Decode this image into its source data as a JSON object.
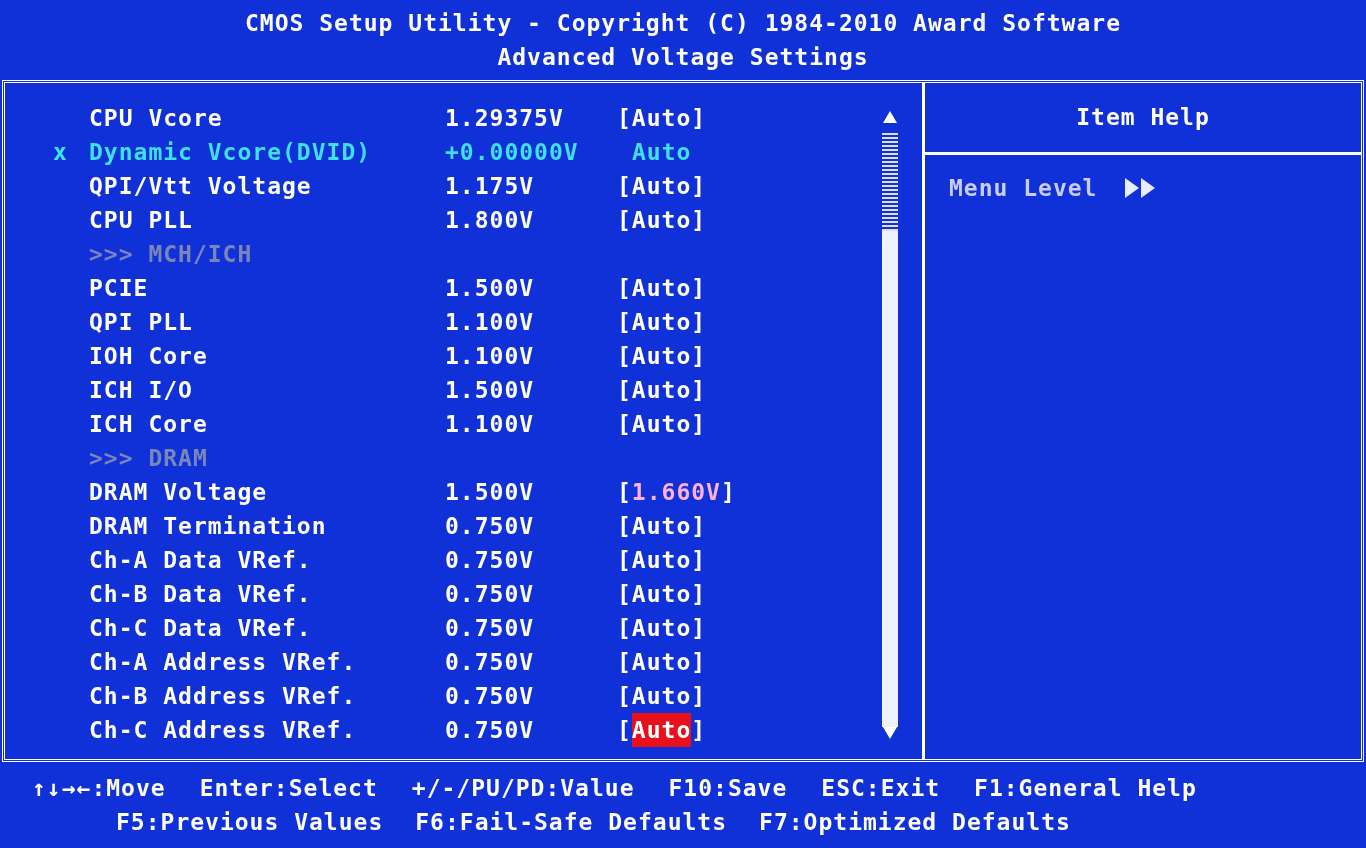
{
  "title": "CMOS Setup Utility - Copyright (C) 1984-2010 Award Software",
  "subtitle": "Advanced Voltage Settings",
  "rows": [
    {
      "kind": "item",
      "label": "CPU Vcore",
      "voltage": "1.29375V",
      "open": "[",
      "setting": "Auto",
      "close": "]",
      "disabled": false,
      "modified": false,
      "selected": false
    },
    {
      "kind": "item",
      "marker": "x",
      "label": "Dynamic Vcore(DVID)",
      "voltage": "+0.00000V",
      "setting": "Auto",
      "disabled": true,
      "modified": false,
      "selected": false
    },
    {
      "kind": "item",
      "label": "QPI/Vtt Voltage",
      "voltage": "1.175V",
      "open": "[",
      "setting": "Auto",
      "close": "]",
      "disabled": false,
      "modified": false,
      "selected": false
    },
    {
      "kind": "item",
      "label": "CPU PLL",
      "voltage": "1.800V",
      "open": "[",
      "setting": "Auto",
      "close": "]",
      "disabled": false,
      "modified": false,
      "selected": false
    },
    {
      "kind": "header",
      "label": ">>> MCH/ICH"
    },
    {
      "kind": "item",
      "label": "PCIE",
      "voltage": "1.500V",
      "open": "[",
      "setting": "Auto",
      "close": "]",
      "disabled": false,
      "modified": false,
      "selected": false
    },
    {
      "kind": "item",
      "label": "QPI PLL",
      "voltage": "1.100V",
      "open": "[",
      "setting": "Auto",
      "close": "]",
      "disabled": false,
      "modified": false,
      "selected": false
    },
    {
      "kind": "item",
      "label": "IOH Core",
      "voltage": "1.100V",
      "open": "[",
      "setting": "Auto",
      "close": "]",
      "disabled": false,
      "modified": false,
      "selected": false
    },
    {
      "kind": "item",
      "label": "ICH I/O",
      "voltage": "1.500V",
      "open": "[",
      "setting": "Auto",
      "close": "]",
      "disabled": false,
      "modified": false,
      "selected": false
    },
    {
      "kind": "item",
      "label": "ICH Core",
      "voltage": "1.100V",
      "open": "[",
      "setting": "Auto",
      "close": "]",
      "disabled": false,
      "modified": false,
      "selected": false
    },
    {
      "kind": "header",
      "label": ">>> DRAM"
    },
    {
      "kind": "item",
      "label": "DRAM Voltage",
      "voltage": "1.500V",
      "open": "[",
      "setting": "1.660V",
      "close": "]",
      "disabled": false,
      "modified": true,
      "selected": false
    },
    {
      "kind": "item",
      "label": "DRAM Termination",
      "voltage": "0.750V",
      "open": "[",
      "setting": "Auto",
      "close": "]",
      "disabled": false,
      "modified": false,
      "selected": false
    },
    {
      "kind": "item",
      "label": "Ch-A Data VRef.",
      "voltage": "0.750V",
      "open": "[",
      "setting": "Auto",
      "close": "]",
      "disabled": false,
      "modified": false,
      "selected": false
    },
    {
      "kind": "item",
      "label": "Ch-B Data VRef.",
      "voltage": "0.750V",
      "open": "[",
      "setting": "Auto",
      "close": "]",
      "disabled": false,
      "modified": false,
      "selected": false
    },
    {
      "kind": "item",
      "label": "Ch-C Data VRef.",
      "voltage": "0.750V",
      "open": "[",
      "setting": "Auto",
      "close": "]",
      "disabled": false,
      "modified": false,
      "selected": false
    },
    {
      "kind": "item",
      "label": "Ch-A Address VRef.",
      "voltage": "0.750V",
      "open": "[",
      "setting": "Auto",
      "close": "]",
      "disabled": false,
      "modified": false,
      "selected": false
    },
    {
      "kind": "item",
      "label": "Ch-B Address VRef.",
      "voltage": "0.750V",
      "open": "[",
      "setting": "Auto",
      "close": "]",
      "disabled": false,
      "modified": false,
      "selected": false
    },
    {
      "kind": "item",
      "label": "Ch-C Address VRef.",
      "voltage": "0.750V",
      "open": "[",
      "setting": "Auto",
      "close": "]",
      "disabled": false,
      "modified": false,
      "selected": true
    }
  ],
  "help": {
    "title": "Item Help",
    "menu_level": "Menu Level"
  },
  "footer": [
    [
      "↑↓→←:Move",
      "Enter:Select",
      "+/-/PU/PD:Value",
      "F10:Save",
      "ESC:Exit",
      "F1:General Help"
    ],
    [
      "F5:Previous Values",
      "F6:Fail-Safe Defaults",
      "F7:Optimized Defaults"
    ]
  ]
}
